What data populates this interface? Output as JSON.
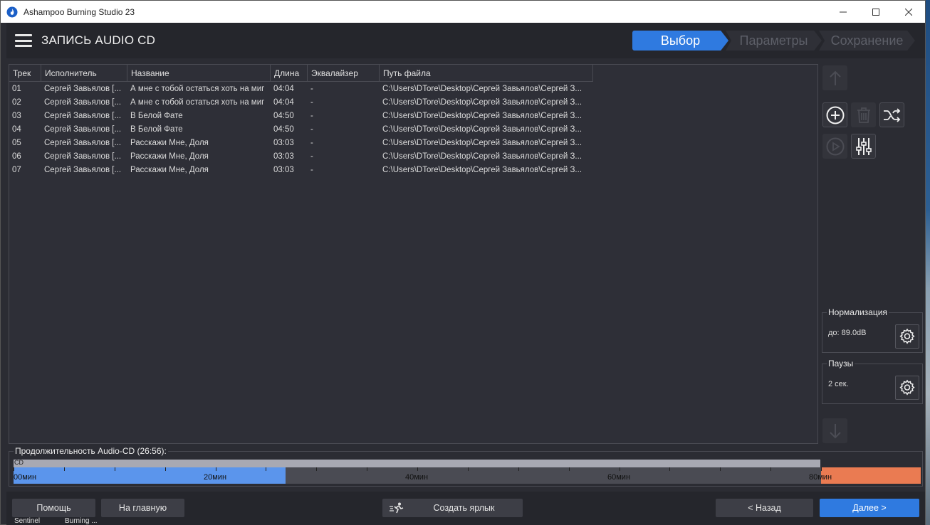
{
  "window": {
    "title": "Ashampoo Burning Studio 23"
  },
  "header": {
    "title": "ЗАПИСЬ AUDIO CD"
  },
  "steps": [
    "Выбор",
    "Параметры",
    "Сохранение"
  ],
  "table": {
    "columns": [
      "Трек",
      "Исполнитель",
      "Название",
      "Длина",
      "Эквалайзер",
      "Путь файла"
    ],
    "rows": [
      [
        "01",
        "Сергей Завьялов [...",
        "А мне с тобой остаться хоть на миг",
        "04:04",
        "-",
        "C:\\Users\\DTore\\Desktop\\Сергей Завьялов\\Сергей З..."
      ],
      [
        "02",
        "Сергей Завьялов [...",
        "А мне с тобой остаться хоть на миг",
        "04:04",
        "-",
        "C:\\Users\\DTore\\Desktop\\Сергей Завьялов\\Сергей З..."
      ],
      [
        "03",
        "Сергей Завьялов [...",
        "В Белой Фате",
        "04:50",
        "-",
        "C:\\Users\\DTore\\Desktop\\Сергей Завьялов\\Сергей З..."
      ],
      [
        "04",
        "Сергей Завьялов [...",
        "В Белой Фате",
        "04:50",
        "-",
        "C:\\Users\\DTore\\Desktop\\Сергей Завьялов\\Сергей З..."
      ],
      [
        "05",
        "Сергей Завьялов [...",
        "Расскажи Мне, Доля",
        "03:03",
        "-",
        "C:\\Users\\DTore\\Desktop\\Сергей Завьялов\\Сергей З..."
      ],
      [
        "06",
        "Сергей Завьялов [...",
        "Расскажи Мне, Доля",
        "03:03",
        "-",
        "C:\\Users\\DTore\\Desktop\\Сергей Завьялов\\Сергей З..."
      ],
      [
        "07",
        "Сергей Завьялов [...",
        "Расскажи Мне, Доля",
        "03:03",
        "-",
        "C:\\Users\\DTore\\Desktop\\Сергей Завьялов\\Сергей З..."
      ]
    ]
  },
  "normalization": {
    "title": "Нормализация",
    "value": "до: 89.0dB"
  },
  "pauses": {
    "title": "Паузы",
    "value": "2 сек."
  },
  "duration": {
    "title": "Продолжительность Audio-CD (26:56):",
    "cd_label": "CD",
    "used_fraction": 0.3367,
    "scale_labels": [
      "00мин",
      "20мин",
      "40мин",
      "60мин",
      "80мин"
    ]
  },
  "buttons": {
    "help": "Помощь",
    "home": "На главную",
    "shortcut": "Создать ярлык",
    "back": "< Назад",
    "next": "Далее >"
  },
  "taskbar": [
    "Sentinel",
    "Burning ..."
  ],
  "colors": {
    "accent": "#2f7ae0",
    "used": "#5b95ec",
    "overflow": "#ea7b52"
  }
}
